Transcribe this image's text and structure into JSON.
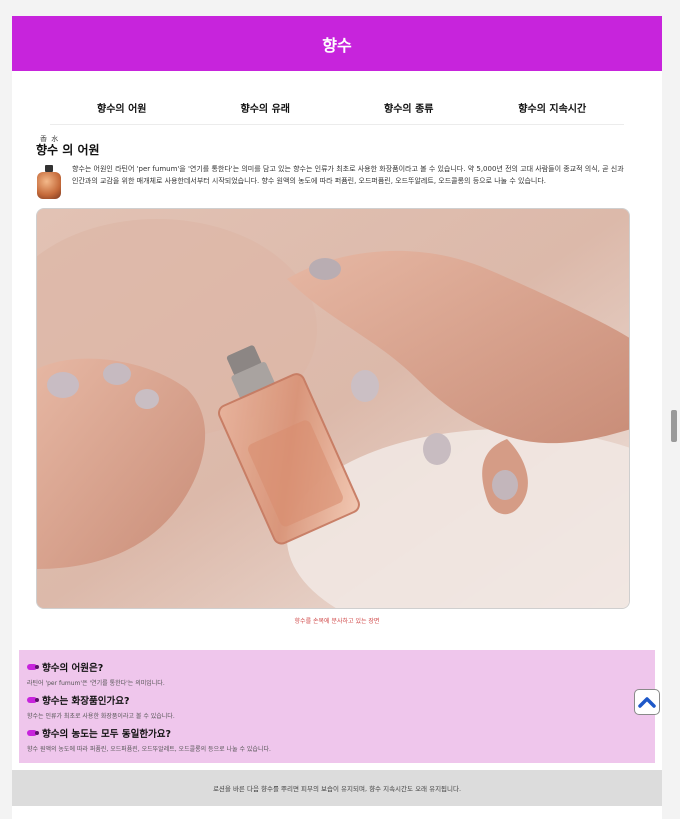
{
  "header": {
    "title": "향수"
  },
  "nav": {
    "items": [
      "향수의 어원",
      "향수의 유래",
      "향수의 종류",
      "향수의 지속시간"
    ]
  },
  "section": {
    "ruby": "香 水",
    "title": "향수 의 어원",
    "intro": "향수는 어원인 라틴어 'per fumum'을 '연기를 통한다'는 의미를 담고 있는 향수는 인류가 최초로 사용한 화장품이라고 볼 수 있습니다. 약 5,000년 전의 고대 사람들이 종교적 의식, 곧 신과 인간과의 교감을 위한 매개체로 사용한데서부터 시작되었습니다. 향수 원액의 농도에 따라 퍼퓸린, 오드퍼퓸린, 오드뚜알레트, 오드콜롱의 등으로 나눌 수 있습니다.",
    "icon": "perfume-bottle-icon",
    "caption": "향수를 손목에 분사하고 있는 장면"
  },
  "faq": {
    "items": [
      {
        "q": "향수의 어원은?",
        "a": "라틴어 'per fumum'은 '연기를 통한다'는 의미입니다."
      },
      {
        "q": "향수는 화장품인가요?",
        "a": "향수는 인류가 최초로 사용한 화장품이라고 볼 수 있습니다."
      },
      {
        "q": "향수의 농도는 모두 동일한가요?",
        "a": "향수 원액의 농도에 따라 퍼퓸린, 오드퍼퓸린, 오드뚜알레트, 오드콜롱의 등으로 나눌 수 있습니다."
      }
    ],
    "icon": "perfume-icon"
  },
  "footer": {
    "text": "로션을 바른 다음 향수를 뿌리면 피부의 보습이 유지되며, 향수 지속시간도 오래 유지됩니다."
  },
  "colors": {
    "brand": "#c724dc",
    "faq_bg": "#efc6ec",
    "footer_bg": "#dcdcdc",
    "caption": "#d04a4a"
  },
  "icons": {
    "top_button": "chevron-up-icon"
  }
}
